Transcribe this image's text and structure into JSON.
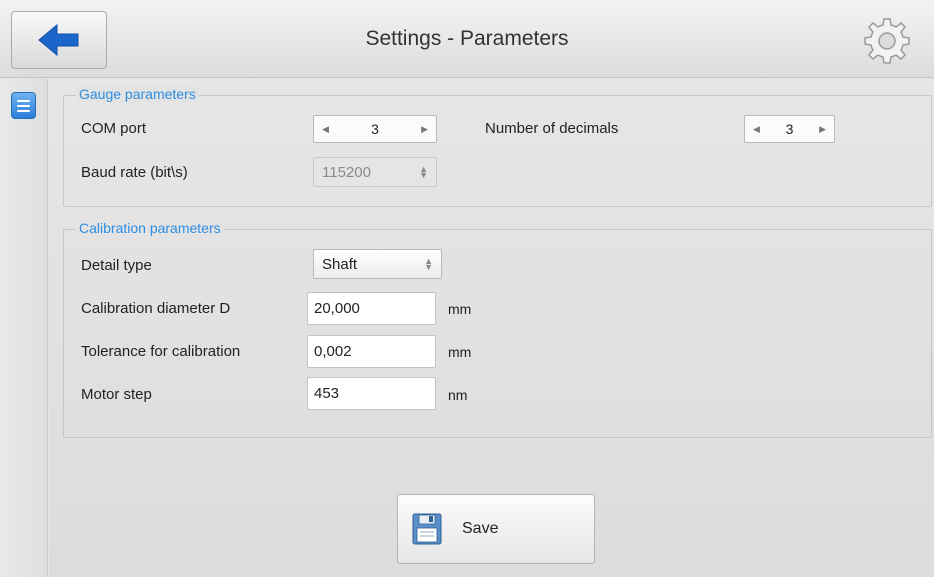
{
  "header": {
    "title": "Settings - Parameters",
    "back_icon": "arrow-left-icon",
    "settings_icon": "gear-icon"
  },
  "sidebar": {
    "menu_icon": "hamburger-icon"
  },
  "gauge": {
    "legend": "Gauge parameters",
    "com_port_label": "COM port",
    "com_port_value": "3",
    "decimals_label": "Number of decimals",
    "decimals_value": "3",
    "baud_label": "Baud rate (bit\\s)",
    "baud_value": "115200"
  },
  "calibration": {
    "legend": "Calibration parameters",
    "detail_type_label": "Detail type",
    "detail_type_value": "Shaft",
    "diameter_label": "Calibration diameter D",
    "diameter_value": "20,000",
    "diameter_unit": "mm",
    "tolerance_label": "Tolerance for calibration",
    "tolerance_value": "0,002",
    "tolerance_unit": "mm",
    "motor_step_label": "Motor step",
    "motor_step_value": "453",
    "motor_step_unit": "nm"
  },
  "actions": {
    "save_label": "Save",
    "save_icon": "floppy-disk-icon"
  },
  "colors": {
    "accent": "#2e8de0",
    "back_arrow": "#1a66c9",
    "menu_button": "#2a7fd8"
  }
}
